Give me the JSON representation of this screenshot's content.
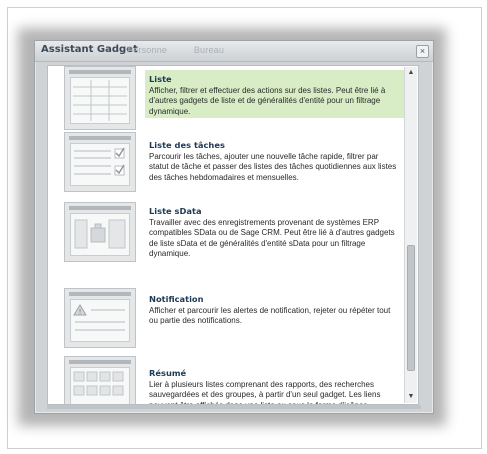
{
  "dialog": {
    "title": "Assistant Gadget",
    "close_icon": "close-icon",
    "background_tabs": [
      "Personne",
      "Bureau"
    ]
  },
  "colors": {
    "selected_bg": "#d8edc6",
    "title_color": "#1e3954"
  },
  "gadgets": [
    {
      "name": "Liste",
      "description": "Afficher, filtrer et effectuer des actions sur des listes. Peut être lié à d'autres gadgets de liste et de généralités d'entité pour un filtrage dynamique.",
      "selected": true,
      "icon": "list-gadget-icon"
    },
    {
      "name": "Liste des tâches",
      "description": "Parcourir les tâches, ajouter une nouvelle tâche rapide, filtrer par statut de tâche et passer des listes des tâches quotidiennes aux listes des tâches hebdomadaires et mensuelles.",
      "selected": false,
      "icon": "task-list-gadget-icon"
    },
    {
      "name": "Liste sData",
      "description": "Travailler avec des enregistrements provenant de systèmes ERP compatibles SData ou de Sage CRM. Peut être lié à d'autres gadgets de liste sData et de généralités d'entité sData pour un filtrage dynamique.",
      "selected": false,
      "icon": "sdata-list-gadget-icon"
    },
    {
      "name": "Notification",
      "description": "Afficher et parcourir les alertes de notification, rejeter ou répéter tout ou partie des notifications.",
      "selected": false,
      "icon": "notification-gadget-icon"
    },
    {
      "name": "Résumé",
      "description": "Lier à plusieurs listes comprenant des rapports, des recherches sauvegardées et des groupes, à partir d'un seul gadget. Les liens peuvent être affichés dans une liste ou sous la forme d'icônes.",
      "selected": false,
      "icon": "summary-gadget-icon"
    }
  ]
}
